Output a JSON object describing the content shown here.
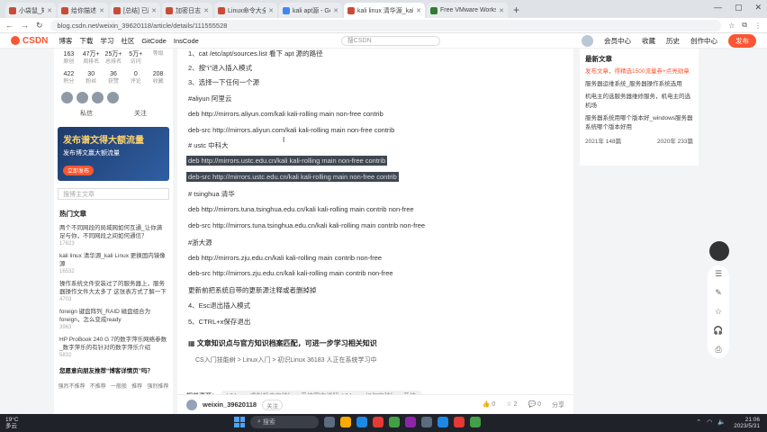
{
  "browser": {
    "tabs": [
      {
        "label": "小袋鼠_知识产品…"
      },
      {
        "label": "给你描述图表…"
      },
      {
        "label": "[总结] 已配置…"
      },
      {
        "label": "加密日志"
      },
      {
        "label": "Linux命令大全(手册) - …"
      },
      {
        "label": "kali apt源 - Google 搜索"
      },
      {
        "label": "kali linux 清华源_kali Li…"
      },
      {
        "label": "Free VMware Workstati…"
      }
    ],
    "url": "blog.csdn.net/weixin_39620118/article/details/111555528",
    "window_controls": [
      "—",
      "▢",
      "✕"
    ]
  },
  "csdn_nav": {
    "logo": "CSDN",
    "links": [
      "博客",
      "下载",
      "学习",
      "社区",
      "GitCode",
      "InsCode"
    ],
    "search_placeholder": "搜CSDN",
    "right_links": [
      "会员中心",
      "收藏",
      "历史",
      "创作中心"
    ],
    "publish": "发布"
  },
  "left": {
    "stats_row1": [
      {
        "v": "163",
        "l": "原创"
      },
      {
        "v": "47万+",
        "l": "周排名"
      },
      {
        "v": "25万+",
        "l": "总排名"
      },
      {
        "v": "5万+",
        "l": "访问"
      },
      {
        "v": "",
        "l": "等级"
      }
    ],
    "stats_row2": [
      {
        "v": "422",
        "l": "积分"
      },
      {
        "v": "30",
        "l": "粉丝"
      },
      {
        "v": "36",
        "l": "获赞"
      },
      {
        "v": "0",
        "l": "评论"
      },
      {
        "v": "208",
        "l": "收藏"
      }
    ],
    "buttons": [
      "私信",
      "关注"
    ],
    "banner_title": "发布谱文得大额流量",
    "banner_sub": "发布博文赢大额流量",
    "banner_cta": "立即发布",
    "search_placeholder": "搜博主文章",
    "hot_title": "热门文章",
    "hot_items": [
      {
        "title": "两个不同网段的局域网如何互通_让你满足与你，不同网段之间如何通信？",
        "views": "17823"
      },
      {
        "title": "kali linux 清华源_kali Linux 更换国内镜像源",
        "views": "16532"
      },
      {
        "title": "操作系统文件安装过了的服务器上，服务器操作文件大太多了 这张表方式了解一下",
        "views": "4703"
      },
      {
        "title": "foreign 键盘阵列_RAID 磁盘组合为foreign，怎么变成ready",
        "views": "3963"
      },
      {
        "title": "HP ProBook 240 G 7的数字萍乐网络参数_数字萍乐的有针对的数字萍乐介绍",
        "views": "5832"
      }
    ],
    "feedback_q": "您愿意向朋友推荐“博客详情页”吗？",
    "emos": [
      "强烈不推荐",
      "不推荐",
      "一般般",
      "推荐",
      "强烈推荐"
    ]
  },
  "article": {
    "lines": [
      "1、cat /etc/apt/sources.list 看下 apt 源的路径",
      "2、按\"i\"进入插入模式",
      "3、选择一下任何一个源",
      "#aliyun 阿里云",
      "deb http://mirrors.aliyun.com/kali kali-rolling main non-free contrib",
      "deb-src http://mirrors.aliyun.com/kali kali-rolling main non-free contrib",
      "# ustc 中科大",
      "deb http://mirrors.ustc.edu.cn/kali kali-rolling main non-free contrib",
      "deb-src http://mirrors.ustc.edu.cn/kali kali-rolling main non-free contrib",
      "# tsinghua 清华",
      "deb http://mirrors.tuna.tsinghua.edu.cn/kali kali-rolling main contrib non-free",
      "deb-src http://mirrors.tuna.tsinghua.edu.cn/kali kali-rolling main contrib non-free",
      "#浙大源",
      "deb http://mirrors.zju.edu.cn/kali kali-rolling main contrib non-free",
      "deb-src http://mirrors.zju.edu.cn/kali kali-rolling main contrib non-free",
      "更新前把系统自带的更新源注释或者删掉掉",
      "4、Esc退出插入模式",
      "5、CTRL+x保存退出"
    ],
    "knowledge_title": "文章知识点与官方知识档案匹配，可进一步学习相关知识",
    "knowledge_path": "CS入门技能树 > Linux入门 > 初识Linux   36183 人正在系统学习中",
    "tags_label": "相关资源：",
    "tags_text": "VMware虚拟机中安装linux系统图文详解_VMware如何安装linux系统",
    "author": "weixin_39620118",
    "follow": "关注",
    "actions": [
      "👍 0",
      "☆ 2",
      "💬 0",
      "分享"
    ]
  },
  "right": {
    "title": "最新文章",
    "ad": "发布文章，得精选1500流量券+点亮勋章",
    "items": [
      "服务器运维系统_服务器操作系统选用",
      "机电主的选服务器维修服务，机电主的选机场",
      "服务器系统用哪个版本好_windows服务器系统哪个版本好用"
    ],
    "archive": [
      {
        "y": "2021年",
        "n": "148篇"
      },
      {
        "y": "2020年",
        "n": "233篇"
      }
    ]
  },
  "toolbar_icons": [
    "list-icon",
    "comment-icon",
    "star-icon",
    "headset-icon",
    "gift-icon"
  ],
  "taskbar": {
    "weather_temp": "19°C",
    "weather_desc": "多云",
    "search": "搜索",
    "time": "21:06",
    "date": "2023/5/31"
  }
}
